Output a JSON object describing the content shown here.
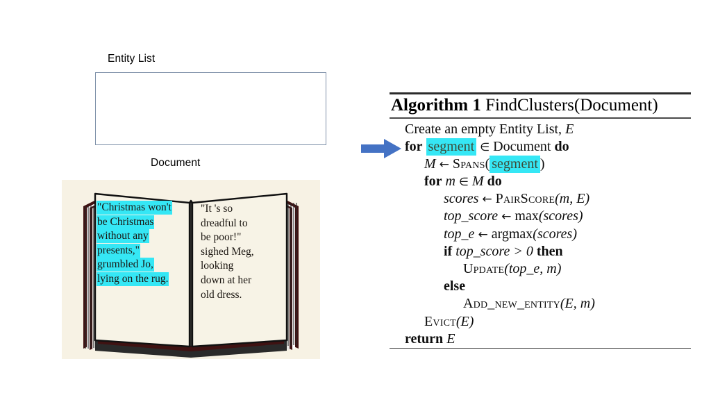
{
  "slide": {
    "background_color": "#ffffff"
  },
  "left_panel": {
    "entity_list_label": "Entity List",
    "entity_list_box": {
      "border_color": "#7e90a8",
      "fill_color": "#ffffff",
      "content": ""
    },
    "document_label": "Document"
  },
  "book_figure": {
    "name": "open-book-illustration",
    "background_color": "#f7f2e4",
    "cover_color": "#3f1212",
    "page_color": "#f7f3e6",
    "highlight_color": "#35e7f5",
    "left_page_lines": [
      {
        "text": "\"Christmas won't",
        "highlighted": true
      },
      {
        "text": "be Christmas",
        "highlighted": true
      },
      {
        "text": "without any",
        "highlighted": true
      },
      {
        "text": "presents,\"",
        "highlighted": true
      },
      {
        "text": "grumbled Jo,",
        "highlighted": true
      },
      {
        "text": "lying on the rug.",
        "highlighted": true
      }
    ],
    "right_page_lines": [
      {
        "text": "\"It 's so",
        "highlighted": false
      },
      {
        "text": "dreadful to",
        "highlighted": false
      },
      {
        "text": "be poor!\"",
        "highlighted": false
      },
      {
        "text": "sighed Meg,",
        "highlighted": false
      },
      {
        "text": "looking",
        "highlighted": false
      },
      {
        "text": "down at her",
        "highlighted": false
      },
      {
        "text": "old dress.",
        "highlighted": false
      }
    ]
  },
  "pointer": {
    "name": "blue-right-arrow",
    "color": "#4472c4",
    "points_to": "for segment in Document do"
  },
  "algorithm": {
    "number_label": "Algorithm 1",
    "signature": "FindClusters(Document)",
    "highlight_color": "#35e7f5",
    "lines": [
      {
        "indent": 0,
        "id": "create-entity-list"
      },
      {
        "indent": 0,
        "id": "for-segment"
      },
      {
        "indent": 1,
        "id": "spans"
      },
      {
        "indent": 1,
        "id": "for-m"
      },
      {
        "indent": 2,
        "id": "scores"
      },
      {
        "indent": 2,
        "id": "top-score"
      },
      {
        "indent": 2,
        "id": "top-e"
      },
      {
        "indent": 2,
        "id": "if-top-score"
      },
      {
        "indent": 3,
        "id": "update"
      },
      {
        "indent": 2,
        "id": "else"
      },
      {
        "indent": 3,
        "id": "add-new-entity"
      },
      {
        "indent": 1,
        "id": "evict"
      },
      {
        "indent": 0,
        "id": "return"
      }
    ],
    "text": {
      "create_entity_list": "Create an empty Entity List,",
      "create_entity_list_var": "E",
      "for_kw": "for",
      "segment": "segment",
      "in_op": "∈",
      "document": "Document",
      "do_kw": "do",
      "m_var": "M",
      "assign": "←",
      "spans_fn": "Spans",
      "for_m_var": "m",
      "set_m": "M",
      "scores_var": "scores",
      "pairscore_fn": "PairScore",
      "pairscore_args": "(m, E)",
      "top_score_var": "top_score",
      "max_fn": "max",
      "max_args": "(scores)",
      "top_e_var": "top_e",
      "argmax_fn": "argmax",
      "argmax_args": "(scores)",
      "if_kw": "if",
      "if_cond": "top_score > 0",
      "then_kw": "then",
      "update_fn": "Update",
      "update_args": "(top_e, m)",
      "else_kw": "else",
      "add_new_entity_fn": "Add_new_entity",
      "add_new_entity_args": "(E, m)",
      "evict_fn": "Evict",
      "evict_args": "(E)",
      "return_kw": "return",
      "return_var": "E"
    }
  }
}
